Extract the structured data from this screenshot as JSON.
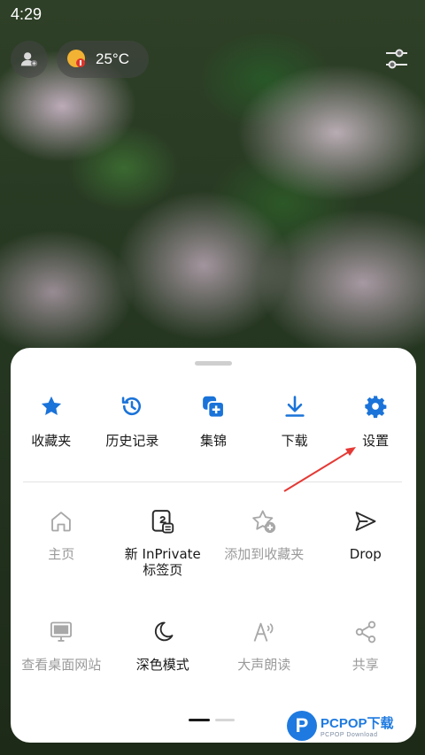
{
  "status_bar": {
    "time": "4:29"
  },
  "top_bar": {
    "weather_temp": "25°C",
    "icons": [
      "profile-icon",
      "weather-icon",
      "sliders-icon"
    ]
  },
  "menu": {
    "row1": [
      {
        "label": "收藏夹",
        "icon": "star-icon"
      },
      {
        "label": "历史记录",
        "icon": "history-icon"
      },
      {
        "label": "集锦",
        "icon": "collections-icon"
      },
      {
        "label": "下载",
        "icon": "download-icon"
      },
      {
        "label": "设置",
        "icon": "gear-icon"
      }
    ],
    "grid": [
      {
        "label": "主页",
        "icon": "home-icon",
        "enabled": false
      },
      {
        "label": "新 InPrivate\n标签页",
        "icon": "inprivate-tab-icon",
        "enabled": true
      },
      {
        "label": "添加到收藏夹",
        "icon": "add-favorite-icon",
        "enabled": false
      },
      {
        "label": "Drop",
        "icon": "send-icon",
        "enabled": true
      },
      {
        "label": "查看桌面网站",
        "icon": "desktop-icon",
        "enabled": false
      },
      {
        "label": "深色模式",
        "icon": "moon-icon",
        "enabled": true
      },
      {
        "label": "大声朗读",
        "icon": "read-aloud-icon",
        "enabled": false
      },
      {
        "label": "共享",
        "icon": "share-icon",
        "enabled": false
      }
    ],
    "page_indicator": {
      "current": 1,
      "total": 2
    }
  },
  "watermark": {
    "logo": "P",
    "text": "PCPOP下载",
    "sub": "PCPOP Download"
  },
  "colors": {
    "accent": "#1a73d9",
    "arrow": "#e53935"
  }
}
